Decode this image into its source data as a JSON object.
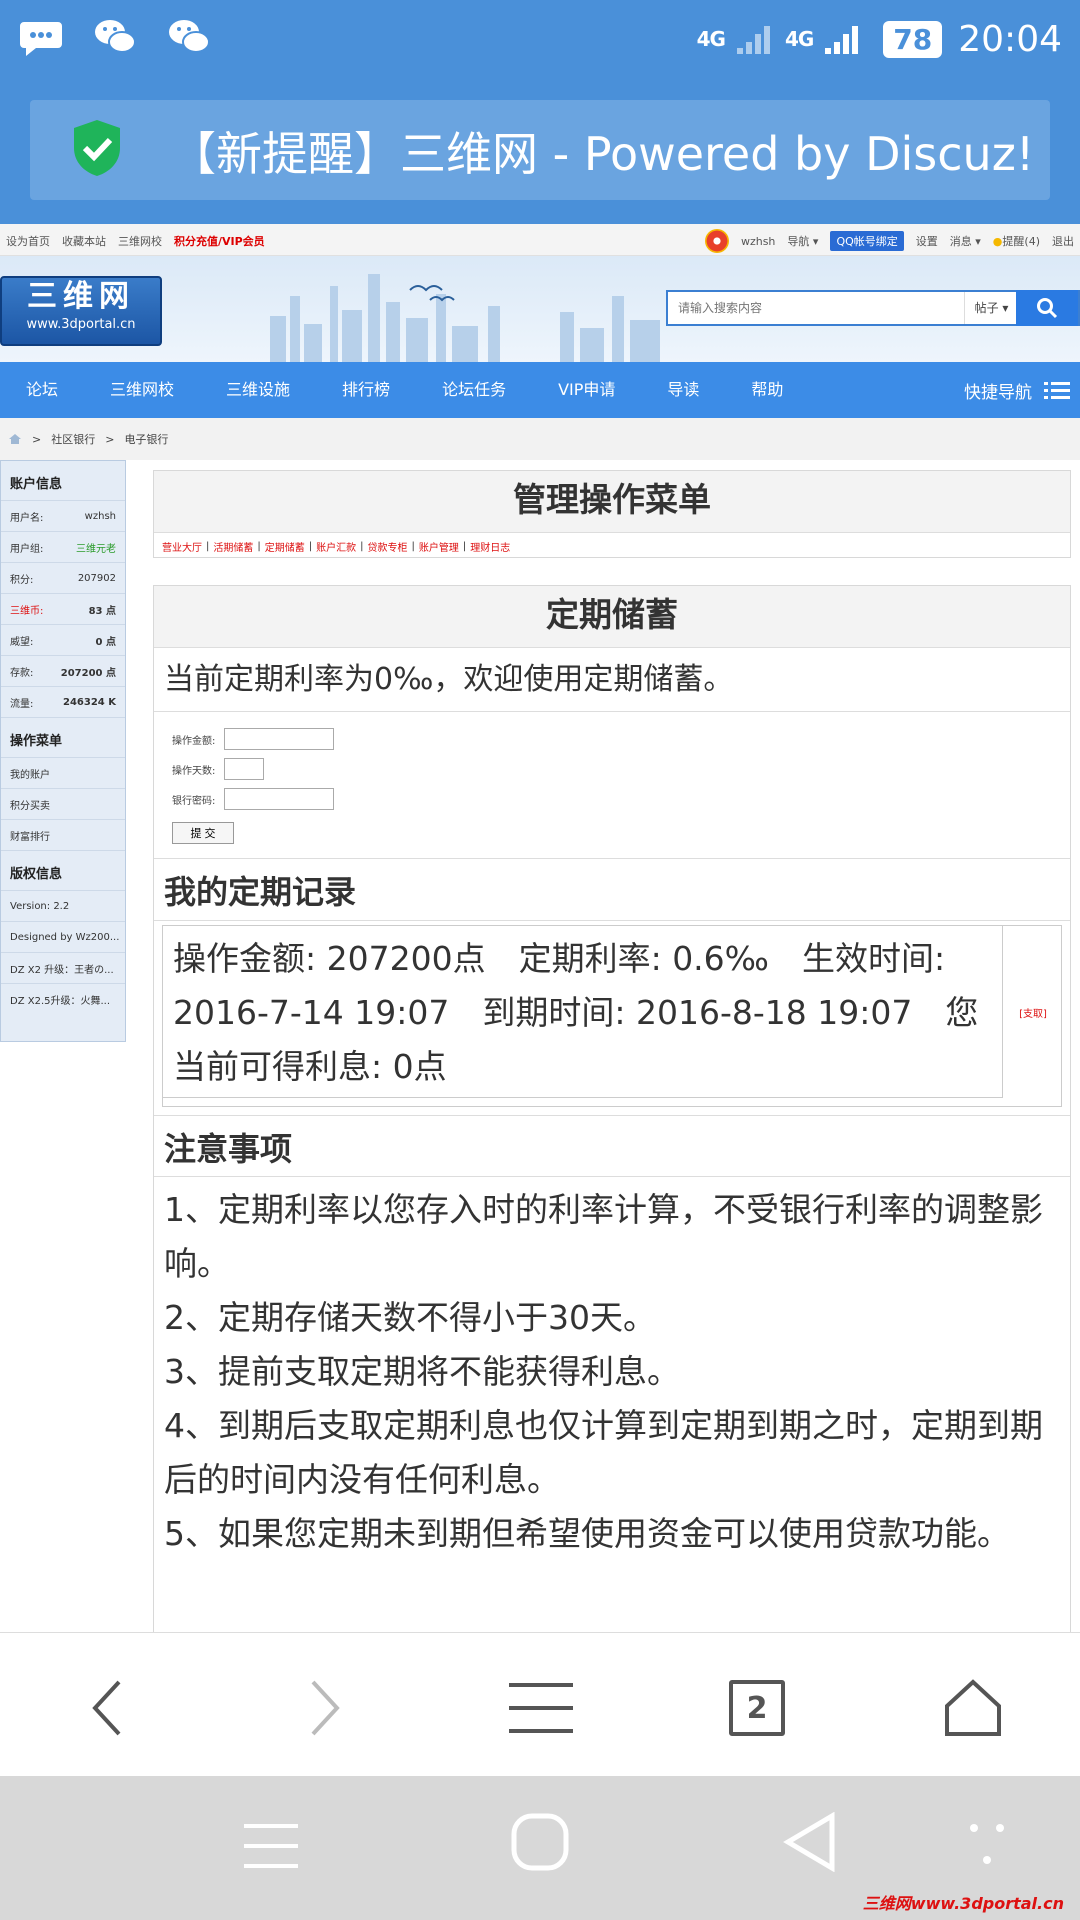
{
  "status_bar": {
    "net1": "4G",
    "net2": "4G",
    "battery": "78",
    "time": "20:04"
  },
  "notification": {
    "title": "【新提醒】三维网 - Powered by Discuz!"
  },
  "top_links": {
    "left": [
      "设为首页",
      "收藏本站",
      "三维网校"
    ],
    "recharge": "积分充值/VIP会员",
    "username": "wzhsh",
    "nav_menu": "导航",
    "qq_bind": "QQ帐号绑定",
    "settings": "设置",
    "messages": "消息",
    "reminders": "提醒(4)",
    "logout": "退出"
  },
  "header": {
    "logo_text": "三维网",
    "logo_url": "www.3dportal.cn",
    "search_placeholder": "请输入搜索内容",
    "search_type": "帖子"
  },
  "nav": {
    "items": [
      "论坛",
      "三维网校",
      "三维设施",
      "排行榜",
      "论坛任务",
      "VIP申请",
      "导读",
      "帮助"
    ],
    "quick": "快捷导航"
  },
  "breadcrumb": [
    "社区银行",
    "电子银行"
  ],
  "sidebar": {
    "account_title": "账户信息",
    "account_rows": [
      {
        "label": "用户名:",
        "value": "wzhsh"
      },
      {
        "label": "用户组:",
        "value": "三维元老"
      },
      {
        "label": "积分:",
        "value": "207902"
      },
      {
        "label": "三维币:",
        "value": "83 点"
      },
      {
        "label": "威望:",
        "value": "0 点"
      },
      {
        "label": "存款:",
        "value": "207200 点"
      },
      {
        "label": "流量:",
        "value": "246324 K"
      }
    ],
    "menu_title": "操作菜单",
    "menu_items": [
      "我的账户",
      "积分买卖",
      "财富排行"
    ],
    "copyright_title": "版权信息",
    "copyright_items": [
      "Version: 2.2",
      "Designed by Wz200...",
      "DZ X2 升级：王者の...",
      "DZ X2.5升级：火舞..."
    ]
  },
  "admin_panel": {
    "title": "管理操作菜单",
    "links": [
      "营业大厅",
      "活期储蓄",
      "定期储蓄",
      "账户汇款",
      "贷款专柜",
      "账户管理",
      "理财日志"
    ]
  },
  "deposit": {
    "title": "定期储蓄",
    "intro": "当前定期利率为0‰，欢迎使用定期储蓄。",
    "amount_label": "操作金额:",
    "days_label": "操作天数:",
    "password_label": "银行密码:",
    "submit": "提 交",
    "records_title": "我的定期记录",
    "record_text": "操作金额: 207200点　定期利率: 0.6‰　生效时间: 2016-7-14 19:07　到期时间: 2016-8-18 19:07　您当前可得利息: 0点",
    "record_action": "[支取]",
    "notes_title": "注意事项",
    "notes": [
      "1、定期利率以您存入时的利率计算，不受银行利率的调整影响。",
      "2、定期存储天数不得小于30天。",
      "3、提前支取定期将不能获得利息。",
      "4、到期后支取定期利息也仅计算到定期到期之时，定期到期后的时间内没有任何利息。",
      "5、如果您定期未到期但希望使用资金可以使用贷款功能。"
    ]
  },
  "toolbar": {
    "tab_count": "2"
  },
  "watermark": "三维网www.3dportal.cn",
  "colors": {
    "status_blue": "#4a90d9",
    "nav_blue": "#3c8ce7",
    "link_red": "#dd1111",
    "group_green": "#2a9b2a"
  },
  "icons": [
    "message-icon",
    "wechat-icon",
    "shield-check-icon",
    "search-icon",
    "menu-icon",
    "back-icon",
    "forward-icon",
    "tabs-icon",
    "home-icon"
  ]
}
